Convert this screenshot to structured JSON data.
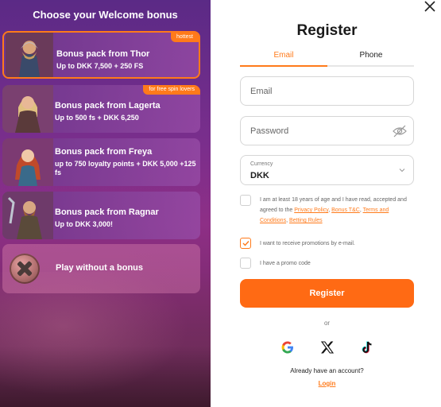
{
  "left_panel": {
    "title": "Choose your Welcome bonus",
    "bonuses": [
      {
        "title": "Bonus pack from Thor",
        "subtitle": "Up to DKK 7,500 + 250 FS",
        "badge": "hottest",
        "selected": true
      },
      {
        "title": "Bonus pack from Lagerta",
        "subtitle": "Up to 500 fs + DKK 6,250",
        "badge": "for free spin lovers",
        "selected": false
      },
      {
        "title": "Bonus pack from Freya",
        "subtitle": "up to 750 loyalty points + DKK 5,000 +125 fs",
        "badge": "",
        "selected": false
      },
      {
        "title": "Bonus pack from Ragnar",
        "subtitle": "Up to DKK 3,000!",
        "badge": "",
        "selected": false
      }
    ],
    "no_bonus_label": "Play without a bonus"
  },
  "form": {
    "title": "Register",
    "tabs": {
      "email": "Email",
      "phone": "Phone",
      "active": "email"
    },
    "email_placeholder": "Email",
    "password_placeholder": "Password",
    "currency_label": "Currency",
    "currency_value": "DKK",
    "consent": {
      "text_before": "I am at least 18 years of age and I have read, accepted and agreed to the ",
      "privacy_link": "Privacy Policy",
      "sep1": ", ",
      "bonus_link": "Bonus T&C",
      "sep2": ", ",
      "terms_link": "Terms and Conditions",
      "sep3": ", ",
      "betting_link": "Betting Rules",
      "checked": false
    },
    "promotions_label": "I want to receive promotions by e-mail.",
    "promotions_checked": true,
    "promo_code_label": "I have a promo code",
    "promo_code_checked": false,
    "register_button": "Register",
    "or_text": "or",
    "socials": [
      "google-icon",
      "x-icon",
      "tiktok-icon"
    ],
    "account_text": "Already have an account?",
    "login_link": "Login"
  },
  "colors": {
    "accent": "#ff6a14",
    "panel_purple": "#7a2e8c"
  }
}
